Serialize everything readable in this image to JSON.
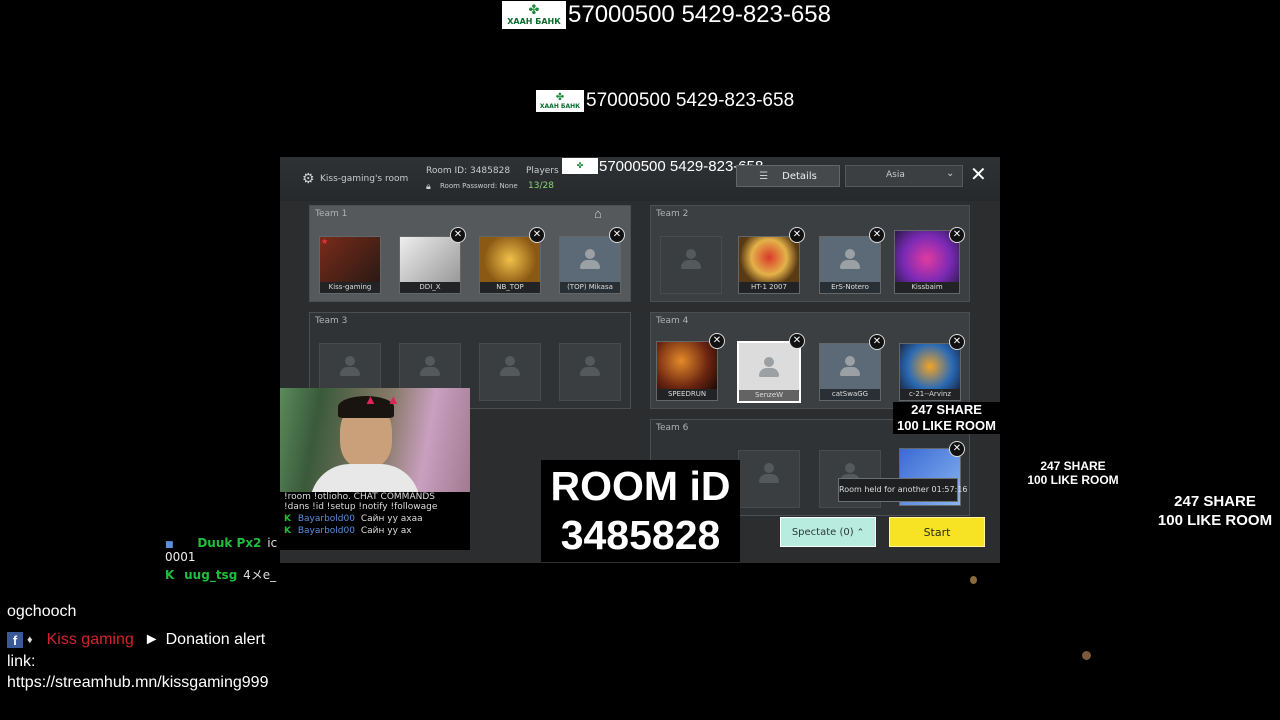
{
  "bank": {
    "logo_text": "ХААН БАНК",
    "account_line": "57000500 5429-823-658"
  },
  "game": {
    "room_owner": "Kiss-gaming's room",
    "room_id_label": "Room ID: 3485828",
    "room_password": "Room Password: None",
    "players_label": "Players",
    "players_count": "13/28",
    "details_button": "Details",
    "region": "Asia",
    "close_symbol": "✕",
    "teams": [
      {
        "label": "Team 1",
        "slots": [
          "Kiss-gaming",
          "DDI_X",
          "NB_TOP",
          "(TOP) Mikasa"
        ]
      },
      {
        "label": "Team 2",
        "slots": [
          "",
          "HT-1 2007",
          "ErS-Notero",
          "Kissbaim"
        ]
      },
      {
        "label": "Team 3",
        "slots": [
          "",
          "",
          "",
          ""
        ]
      },
      {
        "label": "Team 4",
        "slots": [
          "SPEEDRUN",
          "SenzeW",
          "catSwaGG",
          "c-21--Arvinz"
        ]
      },
      {
        "label": "Team 6",
        "slots": [
          "",
          "",
          "",
          ""
        ]
      }
    ],
    "room_held_text": "Room held for another 01:57:16",
    "spectate_button": "Spectate (0)",
    "start_button": "Start"
  },
  "overlay": {
    "room_id_big": "ROOM iD",
    "room_id_number": "3485828",
    "share_line1": "247 SHARE",
    "share_line2": "100 LIKE ROOM"
  },
  "chat_commands": {
    "header": "!room !otlioho. CHAT COMMANDS",
    "commands": "!dans !id !setup !notify !followage",
    "messages": [
      {
        "user": "Bayarbold00",
        "text": "Сайн уу ахаа"
      },
      {
        "user": "Bayarbold00",
        "text": "Сайн уу ах"
      }
    ]
  },
  "left_chat": [
    {
      "user": "Duuk Px2",
      "text": "ic"
    },
    {
      "user": "",
      "text": "0001"
    },
    {
      "user": "uug_tsg",
      "text": "4メe_"
    }
  ],
  "footer": {
    "line1": "ogchooch",
    "channel_name": "Kiss gaming",
    "arrow": "►",
    "alert_text": "Donation alert",
    "link_label": "link:",
    "link_url": "https://streamhub.mn/kissgaming999"
  },
  "colors": {
    "start_yellow": "#f7e224",
    "spectate_teal": "#b8ecdf",
    "channel_red": "#d4232f",
    "chat_user_blue": "#5a8fe0",
    "chat_green": "#1fbf3b"
  }
}
